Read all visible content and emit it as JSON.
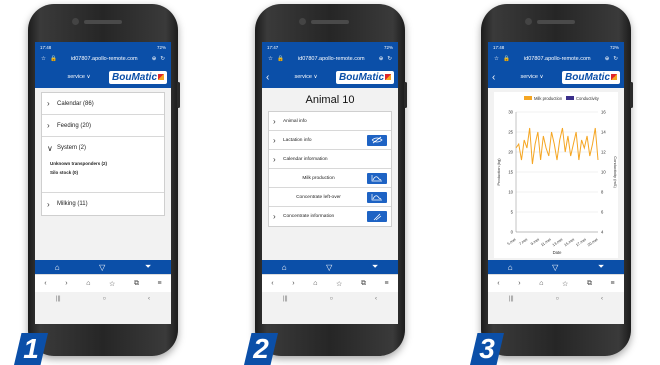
{
  "browser": {
    "status_left": [
      "17:48",
      "17:47",
      "17:48"
    ],
    "status_right": "72%",
    "url": "id07807.apollo-remote.com"
  },
  "app": {
    "service_label": "service ∨",
    "logo_text": "BouMatic",
    "brand_color": "#0b4fa8",
    "accent_color": "#e0262b"
  },
  "screen1": {
    "items": [
      {
        "label": "Calendar (86)"
      },
      {
        "label": "Feeding (20)"
      },
      {
        "label": "System (2)"
      },
      {
        "label": "Milking (11)"
      }
    ],
    "system_sub": [
      "Unknown transponders (2)",
      "Silo stock (0)"
    ]
  },
  "screen2": {
    "title": "Animal 10",
    "rows": [
      {
        "label": "Animal info",
        "has_chevron": true,
        "icon": ""
      },
      {
        "label": "Lactation info",
        "has_chevron": true,
        "icon": "no-milk-icon"
      },
      {
        "label": "Calendar information",
        "has_chevron": true,
        "icon": ""
      },
      {
        "label": "Milk production",
        "has_chevron": false,
        "icon": "graph-icon"
      },
      {
        "label": "Concentrate left-over",
        "has_chevron": false,
        "icon": "graph-icon"
      },
      {
        "label": "Concentrate information",
        "has_chevron": true,
        "icon": "feed-icon"
      }
    ]
  },
  "chart_data": {
    "type": "line",
    "legend": [
      "Milk production",
      "Conductivity"
    ],
    "legend_position": "top",
    "series_colors": [
      "#f5a623",
      "#3b2f8a"
    ],
    "xlabel": "Date",
    "ylabel": "Production (kg)",
    "y2label": "Conductivity (mS)",
    "ylim": [
      0,
      30
    ],
    "y2lim": [
      4,
      16
    ],
    "yticks": [
      0,
      5,
      10,
      15,
      20,
      25,
      30
    ],
    "y2ticks": [
      4,
      6,
      8,
      10,
      12,
      14,
      16
    ],
    "xticks": [
      "5.mei",
      "7.mei",
      "9.mei",
      "11.mei",
      "13.mei",
      "15.mei",
      "17.mei",
      "20.mei"
    ],
    "grid": true,
    "series": [
      {
        "name": "Milk production",
        "values": [
          21,
          22,
          18,
          23,
          21,
          26,
          17,
          22,
          25,
          18,
          24,
          21,
          19,
          25,
          22,
          18,
          23,
          26,
          20,
          24,
          19,
          22,
          25,
          18,
          23,
          21,
          24,
          19,
          22,
          26,
          18
        ]
      }
    ]
  },
  "tabs": [
    "home-icon",
    "udder-icon",
    "filter-icon"
  ],
  "labels": [
    "1",
    "2",
    "3"
  ]
}
